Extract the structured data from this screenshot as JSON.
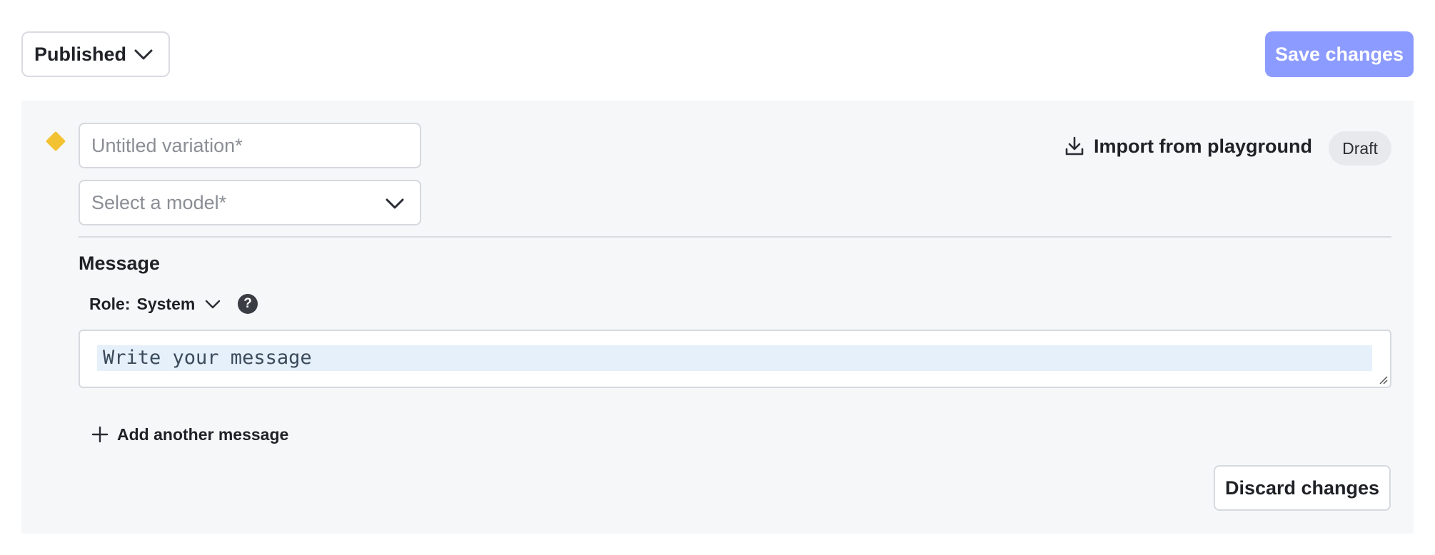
{
  "header": {
    "status_value": "Published",
    "save_label": "Save changes"
  },
  "variation": {
    "name_placeholder": "Untitled variation*",
    "model_placeholder": "Select a model*",
    "import_label": "Import from playground",
    "badge": "Draft"
  },
  "message": {
    "section_title": "Message",
    "role_label": "Role:",
    "role_value": "System",
    "placeholder": "Write your message",
    "add_label": "Add another message"
  },
  "footer": {
    "discard_label": "Discard changes"
  },
  "icons": {
    "status_chevron": "chevron-down-icon",
    "model_chevron": "chevron-down-icon",
    "role_chevron": "chevron-down-icon",
    "import": "download-icon",
    "help": "help-circle-icon",
    "add": "plus-icon",
    "variation_marker": "diamond-icon",
    "resize": "resize-handle-icon"
  },
  "colors": {
    "primary_disabled": "#8c9bff",
    "marker": "#f2c232",
    "panel_bg": "#f6f7f9",
    "badge_bg": "#e7e9ec",
    "text_highlight": "#e6f0fb"
  }
}
